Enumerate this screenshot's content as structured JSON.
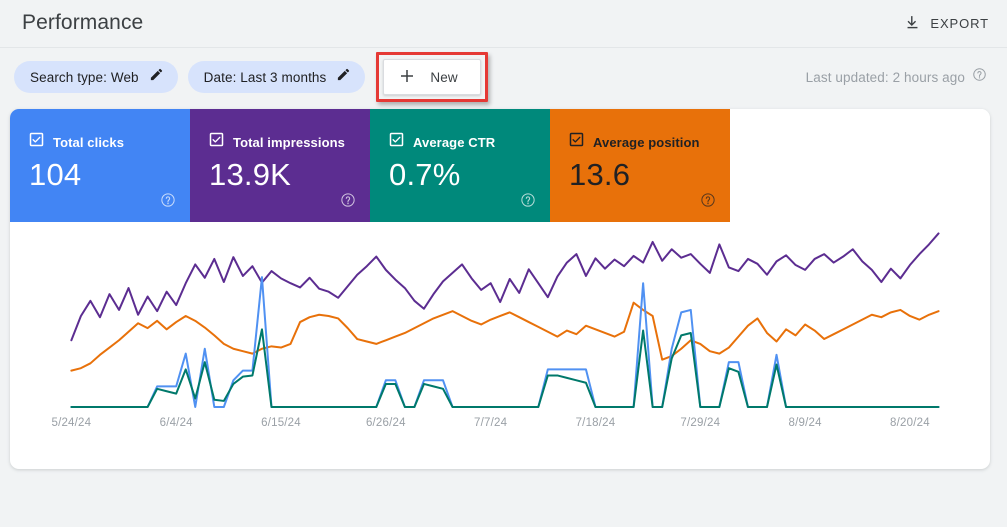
{
  "header": {
    "title": "Performance",
    "export_label": "EXPORT",
    "export_icon": "download-icon"
  },
  "filters": {
    "chips": [
      {
        "label": "Search type: Web",
        "icon": "pencil-icon"
      },
      {
        "label": "Date: Last 3 months",
        "icon": "pencil-icon"
      }
    ],
    "new_button": {
      "label": "New",
      "icon": "plus-icon"
    },
    "last_updated": {
      "text": "Last updated: 2 hours ago",
      "icon": "help-circle-icon"
    },
    "annotation_color": "#E53935"
  },
  "metrics": [
    {
      "name": "Total clicks",
      "value": "104",
      "color": "#4285F4",
      "text_color": "#FFFFFF",
      "checked": true,
      "help_icon": "help-circle-icon"
    },
    {
      "name": "Total impressions",
      "value": "13.9K",
      "color": "#5C2D91",
      "text_color": "#FFFFFF",
      "checked": true,
      "help_icon": "help-circle-icon"
    },
    {
      "name": "Average CTR",
      "value": "0.7%",
      "color": "#00897B",
      "text_color": "#FFFFFF",
      "checked": true,
      "help_icon": "help-circle-icon"
    },
    {
      "name": "Average position",
      "value": "13.6",
      "color": "#E8710A",
      "text_color": "#202124",
      "checked": true,
      "help_icon": "help-circle-icon"
    }
  ],
  "chart_data": {
    "type": "line",
    "title": "Performance",
    "xlabel": "",
    "ylabel": "",
    "grid": false,
    "legend": "none",
    "x_tick_labels": [
      "5/24/24",
      "6/4/24",
      "6/15/24",
      "6/26/24",
      "7/7/24",
      "7/18/24",
      "7/29/24",
      "8/9/24",
      "8/20/24"
    ],
    "x_tick_indices": [
      0,
      11,
      22,
      33,
      44,
      55,
      66,
      77,
      88
    ],
    "n_points": 92,
    "series": [
      {
        "name": "Total impressions",
        "color": "#5C2D91",
        "values": [
          110,
          150,
          175,
          148,
          186,
          160,
          196,
          152,
          182,
          158,
          190,
          168,
          204,
          235,
          213,
          244,
          206,
          247,
          216,
          232,
          205,
          224,
          212,
          204,
          197,
          213,
          195,
          190,
          180,
          199,
          218,
          232,
          248,
          226,
          210,
          196,
          175,
          162,
          186,
          207,
          221,
          235,
          212,
          193,
          204,
          173,
          211,
          188,
          227,
          204,
          181,
          215,
          238,
          252,
          216,
          245,
          228,
          243,
          232,
          249,
          238,
          272,
          241,
          260,
          246,
          252,
          236,
          221,
          268,
          230,
          224,
          244,
          236,
          218,
          240,
          250,
          234,
          226,
          244,
          252,
          238,
          248,
          260,
          240,
          226,
          206,
          228,
          212,
          234,
          252,
          268,
          286
        ]
      },
      {
        "name": "Average position",
        "color": "#E8710A",
        "values": [
          60,
          64,
          72,
          86,
          98,
          110,
          124,
          138,
          130,
          142,
          128,
          140,
          150,
          142,
          131,
          118,
          104,
          96,
          92,
          88,
          96,
          100,
          98,
          104,
          140,
          148,
          152,
          150,
          146,
          130,
          112,
          108,
          104,
          110,
          116,
          122,
          130,
          138,
          146,
          152,
          158,
          150,
          142,
          136,
          144,
          150,
          156,
          148,
          140,
          132,
          124,
          116,
          126,
          120,
          134,
          128,
          122,
          116,
          124,
          172,
          160,
          150,
          78,
          84,
          96,
          110,
          104,
          92,
          88,
          98,
          116,
          134,
          146,
          122,
          108,
          128,
          118,
          136,
          126,
          112,
          120,
          128,
          136,
          144,
          152,
          148,
          156,
          160,
          150,
          144,
          152,
          158
        ]
      },
      {
        "name": "Total clicks",
        "color": "#5091F2",
        "values": [
          0,
          0,
          0,
          0,
          0,
          0,
          0,
          0,
          0,
          34,
          34,
          34,
          88,
          0,
          96,
          0,
          0,
          44,
          60,
          60,
          214,
          0,
          0,
          0,
          0,
          0,
          0,
          0,
          0,
          0,
          0,
          0,
          0,
          44,
          44,
          0,
          0,
          44,
          44,
          44,
          0,
          0,
          0,
          0,
          0,
          0,
          0,
          0,
          0,
          0,
          62,
          62,
          62,
          62,
          62,
          0,
          0,
          0,
          0,
          0,
          204,
          0,
          0,
          96,
          156,
          160,
          0,
          0,
          0,
          74,
          74,
          0,
          0,
          0,
          86,
          0,
          0,
          0,
          0,
          0,
          0,
          0,
          0,
          0,
          0,
          0,
          0,
          0,
          0,
          0,
          0,
          0
        ]
      },
      {
        "name": "Average CTR",
        "color": "#00796B",
        "values": [
          0,
          0,
          0,
          0,
          0,
          0,
          0,
          0,
          0,
          30,
          26,
          22,
          62,
          14,
          74,
          12,
          10,
          38,
          50,
          52,
          128,
          0,
          0,
          0,
          0,
          0,
          0,
          0,
          0,
          0,
          0,
          0,
          0,
          38,
          38,
          0,
          0,
          38,
          34,
          30,
          0,
          0,
          0,
          0,
          0,
          0,
          0,
          0,
          0,
          0,
          52,
          52,
          48,
          44,
          40,
          0,
          0,
          0,
          0,
          0,
          126,
          0,
          0,
          80,
          118,
          122,
          0,
          0,
          0,
          64,
          58,
          0,
          0,
          0,
          70,
          0,
          0,
          0,
          0,
          0,
          0,
          0,
          0,
          0,
          0,
          0,
          0,
          0,
          0,
          0,
          0,
          0
        ]
      }
    ]
  }
}
